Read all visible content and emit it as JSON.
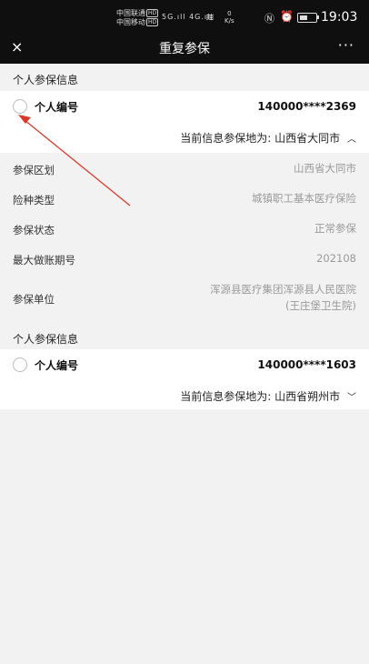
{
  "status_bar": {
    "carrier1": "中国联通",
    "carrier2": "中国移动",
    "hd": "HD",
    "net1": "5G",
    "net2": "4G",
    "speed_value": "0",
    "speed_unit": "K/s",
    "time": "19:03"
  },
  "nav": {
    "close_icon": "×",
    "title": "重复参保",
    "more_icon": "···"
  },
  "records": [
    {
      "section_title": "个人参保信息",
      "id_label": "个人编号",
      "id_value": "140000****2369",
      "location_prefix": "当前信息参保地为:",
      "location": "山西省大同市",
      "expanded": true,
      "details": [
        {
          "label": "参保区划",
          "value": "山西省大同市"
        },
        {
          "label": "险种类型",
          "value": "城镇职工基本医疗保险"
        },
        {
          "label": "参保状态",
          "value": "正常参保"
        },
        {
          "label": "最大做账期号",
          "value": "202108"
        },
        {
          "label": "参保单位",
          "value_line1": "浑源县医疗集团浑源县人民医院",
          "value_line2": "(王庄堡卫生院)"
        }
      ]
    },
    {
      "section_title": "个人参保信息",
      "id_label": "个人编号",
      "id_value": "140000****1603",
      "location_prefix": "当前信息参保地为:",
      "location": "山西省朔州市",
      "expanded": false
    }
  ],
  "colors": {
    "header_bg": "#0f0f0f",
    "page_bg": "#f2f2f2",
    "annotation_arrow": "#d9382a"
  }
}
